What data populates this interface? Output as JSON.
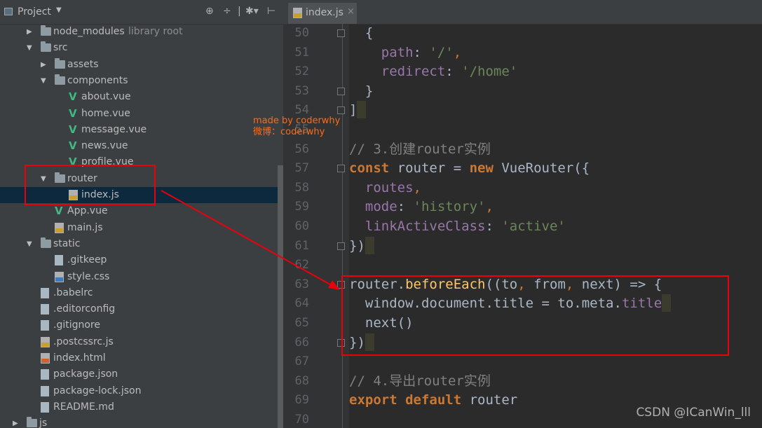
{
  "project_panel": {
    "title": "Project",
    "tree": [
      {
        "label": "node_modules",
        "hint": "library root",
        "type": "folder",
        "depth": 1,
        "expanded": false
      },
      {
        "label": "src",
        "type": "folder",
        "depth": 1,
        "expanded": true
      },
      {
        "label": "assets",
        "type": "folder",
        "depth": 2,
        "expanded": false
      },
      {
        "label": "components",
        "type": "folder",
        "depth": 2,
        "expanded": true
      },
      {
        "label": "about.vue",
        "type": "vue",
        "depth": 3
      },
      {
        "label": "home.vue",
        "type": "vue",
        "depth": 3
      },
      {
        "label": "message.vue",
        "type": "vue",
        "depth": 3
      },
      {
        "label": "news.vue",
        "type": "vue",
        "depth": 3
      },
      {
        "label": "profile.vue",
        "type": "vue",
        "depth": 3
      },
      {
        "label": "router",
        "type": "folder",
        "depth": 2,
        "expanded": true
      },
      {
        "label": "index.js",
        "type": "js",
        "depth": 3,
        "selected": true
      },
      {
        "label": "App.vue",
        "type": "vue",
        "depth": 2
      },
      {
        "label": "main.js",
        "type": "js",
        "depth": 2
      },
      {
        "label": "static",
        "type": "folder",
        "depth": 1,
        "expanded": true
      },
      {
        "label": ".gitkeep",
        "type": "file",
        "depth": 2
      },
      {
        "label": "style.css",
        "type": "css",
        "depth": 2
      },
      {
        "label": ".babelrc",
        "type": "file",
        "depth": 1
      },
      {
        "label": ".editorconfig",
        "type": "file",
        "depth": 1
      },
      {
        "label": ".gitignore",
        "type": "file",
        "depth": 1
      },
      {
        "label": ".postcssrc.js",
        "type": "js",
        "depth": 1
      },
      {
        "label": "index.html",
        "type": "html",
        "depth": 1
      },
      {
        "label": "package.json",
        "type": "file",
        "depth": 1
      },
      {
        "label": "package-lock.json",
        "type": "file",
        "depth": 1
      },
      {
        "label": "README.md",
        "type": "file",
        "depth": 1
      },
      {
        "label": "js",
        "type": "folder",
        "depth": 0,
        "expanded": false
      }
    ]
  },
  "editor": {
    "tab": {
      "label": "index.js",
      "close": "×"
    },
    "line_numbers": [
      "50",
      "51",
      "52",
      "53",
      "54",
      "55",
      "56",
      "57",
      "58",
      "59",
      "60",
      "61",
      "62",
      "63",
      "64",
      "65",
      "66",
      "67",
      "68",
      "69",
      "70"
    ],
    "lines": [
      [
        {
          "t": "  {",
          "c": ""
        }
      ],
      [
        {
          "t": "    path",
          "c": "prop"
        },
        {
          "t": ": ",
          "c": ""
        },
        {
          "t": "'/'",
          "c": "str"
        },
        {
          "t": ",",
          "c": "punc"
        }
      ],
      [
        {
          "t": "    redirect",
          "c": "prop"
        },
        {
          "t": ": ",
          "c": ""
        },
        {
          "t": "'/home'",
          "c": "str"
        }
      ],
      [
        {
          "t": "  }",
          "c": ""
        }
      ],
      [
        {
          "t": "]",
          "c": ""
        }
      ],
      [
        {
          "t": "",
          "c": ""
        }
      ],
      [
        {
          "t": "// 3.创建router实例",
          "c": "cmt"
        }
      ],
      [
        {
          "t": "const ",
          "c": "kw"
        },
        {
          "t": "router = ",
          "c": ""
        },
        {
          "t": "new ",
          "c": "kw"
        },
        {
          "t": "VueRouter({",
          "c": ""
        }
      ],
      [
        {
          "t": "  routes",
          "c": "prop"
        },
        {
          "t": ",",
          "c": "punc"
        }
      ],
      [
        {
          "t": "  mode",
          "c": "prop"
        },
        {
          "t": ": ",
          "c": ""
        },
        {
          "t": "'history'",
          "c": "str"
        },
        {
          "t": ",",
          "c": "punc"
        }
      ],
      [
        {
          "t": "  linkActiveClass",
          "c": "prop"
        },
        {
          "t": ": ",
          "c": ""
        },
        {
          "t": "'active'",
          "c": "str"
        }
      ],
      [
        {
          "t": "})",
          "c": ""
        }
      ],
      [
        {
          "t": "",
          "c": ""
        }
      ],
      [
        {
          "t": "router.",
          "c": ""
        },
        {
          "t": "beforeEach",
          "c": "fn"
        },
        {
          "t": "((to",
          "c": ""
        },
        {
          "t": ", ",
          "c": "punc"
        },
        {
          "t": "from",
          "c": ""
        },
        {
          "t": ", ",
          "c": "punc"
        },
        {
          "t": "next) => {",
          "c": ""
        }
      ],
      [
        {
          "t": "  window.document.title = to.meta.",
          "c": ""
        },
        {
          "t": "title",
          "c": "prop"
        }
      ],
      [
        {
          "t": "  next()",
          "c": ""
        }
      ],
      [
        {
          "t": "})",
          "c": ""
        }
      ],
      [
        {
          "t": "",
          "c": ""
        }
      ],
      [
        {
          "t": "// 4.导出router实例",
          "c": "cmt"
        }
      ],
      [
        {
          "t": "export default ",
          "c": "kw"
        },
        {
          "t": "router",
          "c": ""
        }
      ],
      [
        {
          "t": "",
          "c": ""
        }
      ]
    ]
  },
  "annotation": {
    "line1": "made by coderwhy",
    "line2": "微博：coderwhy"
  },
  "watermark": "CSDN @ICanWin_lll",
  "colors": {
    "highlight_box": "#e8000b",
    "annotation_text": "#ff6a1a",
    "vue_icon": "#41b883"
  }
}
